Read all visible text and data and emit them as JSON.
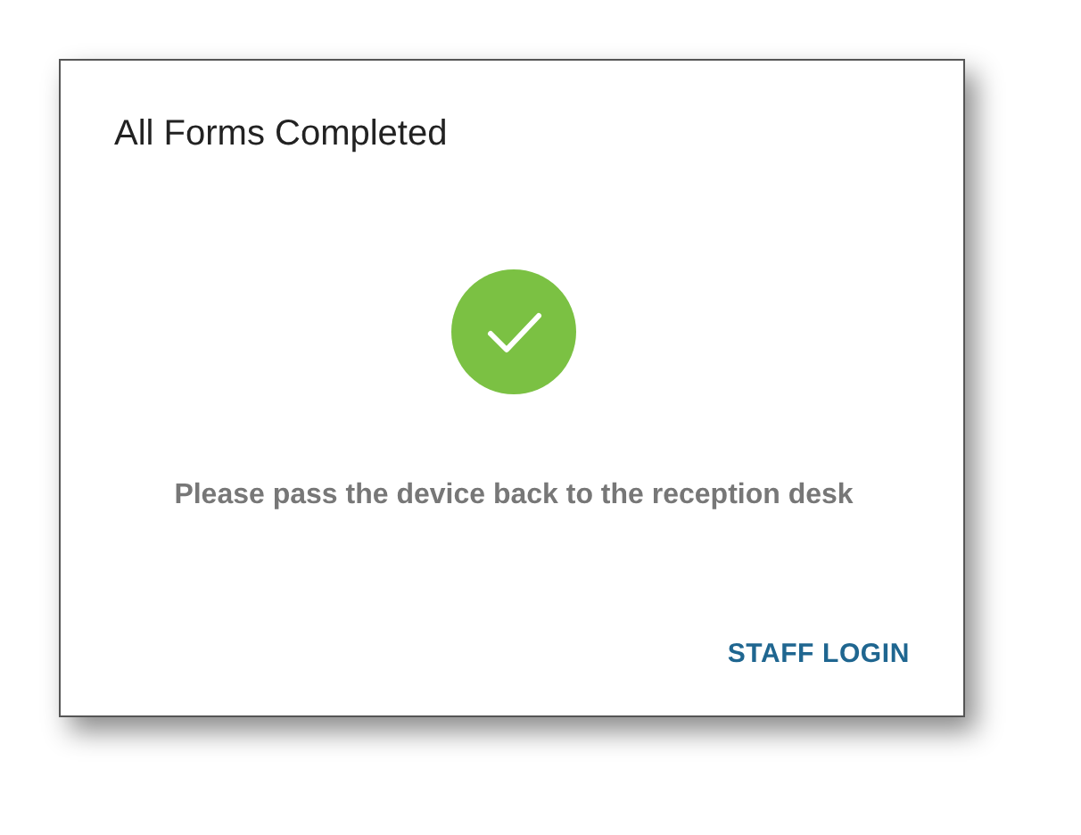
{
  "dialog": {
    "title": "All Forms Completed",
    "message": "Please pass the device back to the reception desk",
    "actions": [
      "STAFF LOGIN"
    ]
  }
}
